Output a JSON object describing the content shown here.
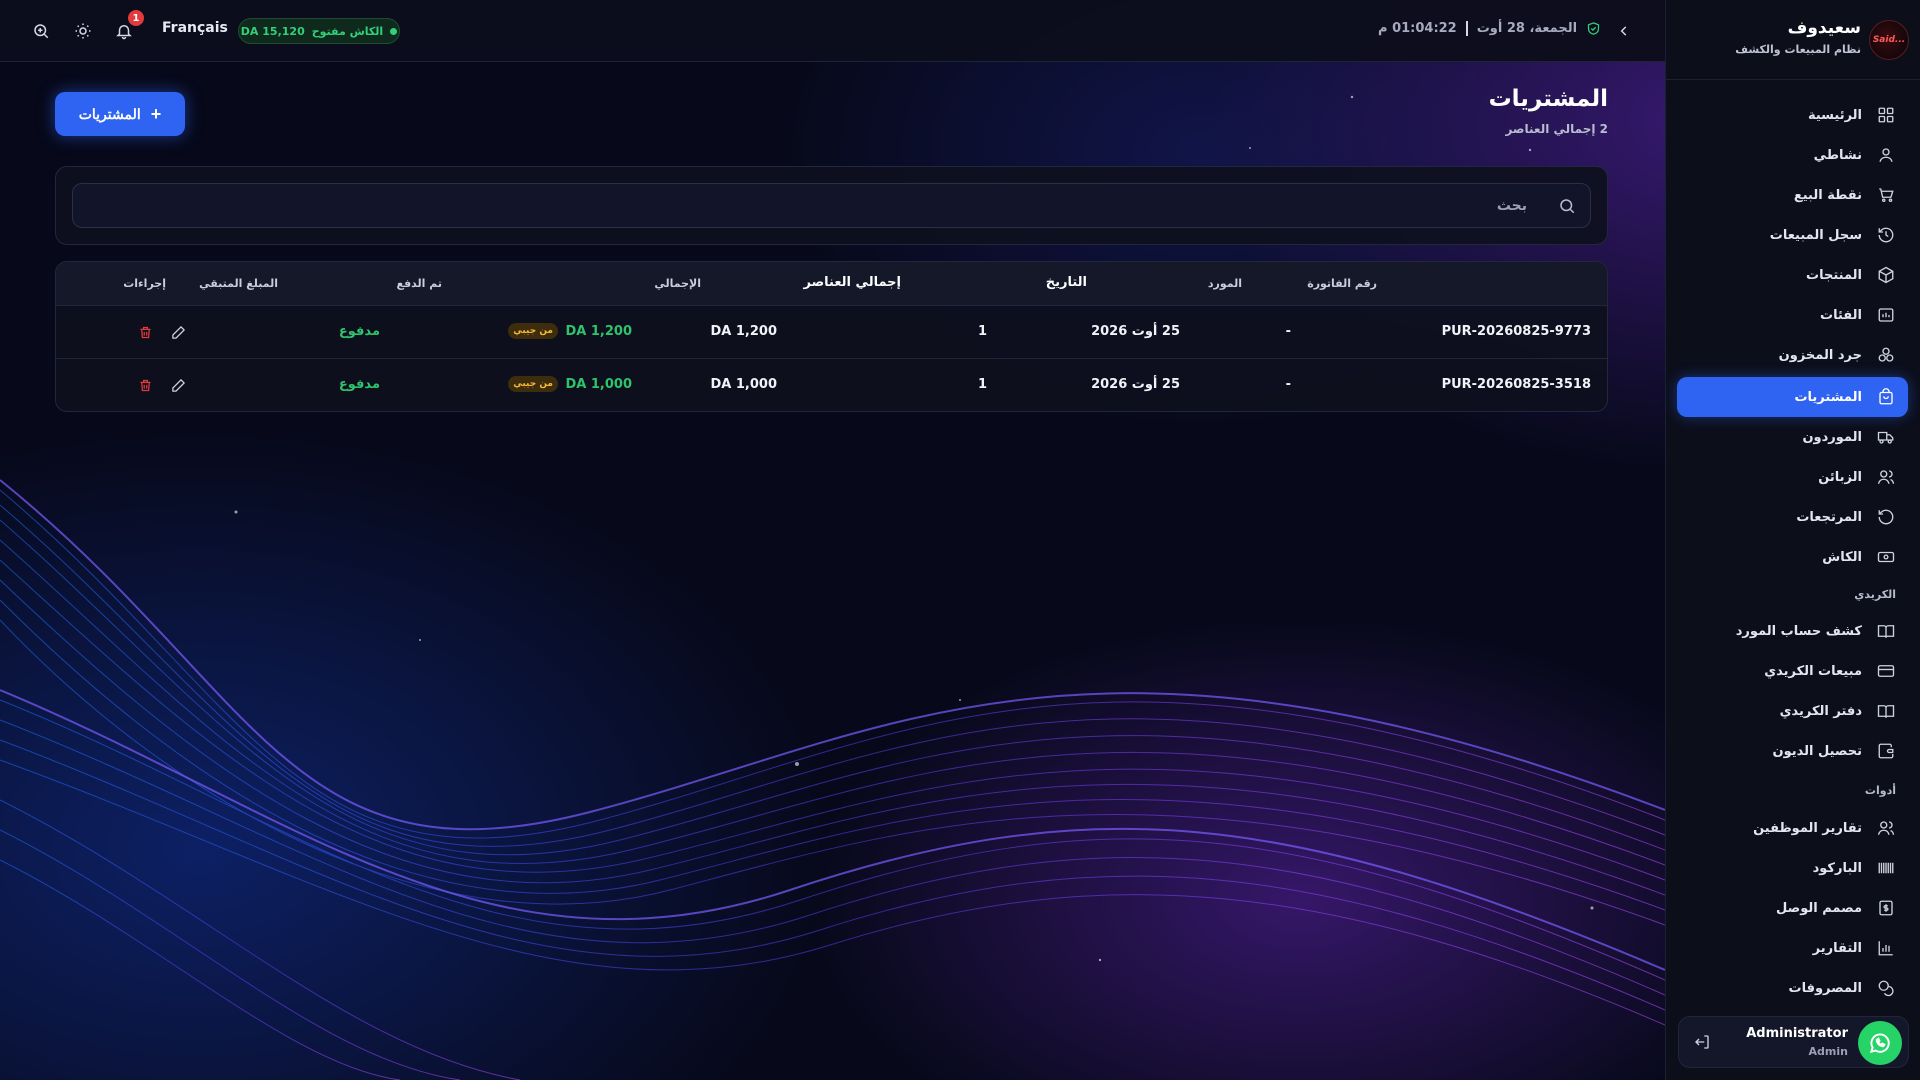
{
  "topbar": {
    "language": "Français",
    "cash_status": "الكاش مفتوح",
    "cash_amount": "DA 15,120",
    "date": "الجمعة، 28 أوت",
    "time": "01:04:22 م",
    "notifications_count": "1"
  },
  "brand": {
    "name": "سعيدوف",
    "subtitle": "نظام المبيعات والكشف",
    "logo_text": "Said..."
  },
  "sidebar": {
    "items": [
      {
        "label": "الرئيسية",
        "icon": "grid-icon"
      },
      {
        "label": "نشاطي",
        "icon": "user-icon"
      },
      {
        "label": "نقطة البيع",
        "icon": "cart-icon"
      },
      {
        "label": "سجل المبيعات",
        "icon": "history-icon"
      },
      {
        "label": "المنتجات",
        "icon": "box-icon"
      },
      {
        "label": "الفئات",
        "icon": "category-icon"
      },
      {
        "label": "جرد المخزون",
        "icon": "stock-icon"
      },
      {
        "label": "المشتريات",
        "icon": "bag-icon"
      },
      {
        "label": "الموردون",
        "icon": "truck-icon"
      },
      {
        "label": "الزبائن",
        "icon": "users-icon"
      },
      {
        "label": "المرتجعات",
        "icon": "return-icon"
      },
      {
        "label": "الكاش",
        "icon": "cash-icon"
      }
    ],
    "credit_section": "الكريدي",
    "credit_items": [
      {
        "label": "كشف حساب المورد",
        "icon": "book-icon"
      },
      {
        "label": "مبيعات الكريدي",
        "icon": "card-icon"
      },
      {
        "label": "دفتر الكريدي",
        "icon": "book-icon"
      },
      {
        "label": "تحصيل الديون",
        "icon": "wallet-icon"
      }
    ],
    "tools_section": "أدوات",
    "tools_items": [
      {
        "label": "تقارير الموظفين",
        "icon": "users-icon"
      },
      {
        "label": "الباركود",
        "icon": "barcode-icon"
      },
      {
        "label": "مصمم الوصل",
        "icon": "receipt-icon"
      },
      {
        "label": "التقارير",
        "icon": "chart-icon"
      },
      {
        "label": "المصروفات",
        "icon": "coins-icon"
      }
    ]
  },
  "user": {
    "name": "Administrator",
    "role": "Admin"
  },
  "page": {
    "title": "المشتريات",
    "subtitle": "2 إجمالي العناصر",
    "add_button": "المشتريات",
    "search_placeholder": "بحث"
  },
  "table": {
    "headers": {
      "invoice": "رقم الفاتورة",
      "supplier": "المورد",
      "date": "التاريخ",
      "items_total": "إجمالي العناصر",
      "total": "الإجمالي",
      "paid": "تم الدفع",
      "remaining": "المبلغ المتبقي",
      "actions": "إجراءات"
    },
    "rows": [
      {
        "invoice": "PUR-20260825-9773",
        "supplier": "-",
        "date": "25 أوت 2026",
        "items": "1",
        "total": "DA 1,200",
        "paid": "DA 1,200",
        "paid_source": "من جيبي",
        "remaining": "مدفوع"
      },
      {
        "invoice": "PUR-20260825-3518",
        "supplier": "-",
        "date": "25 أوت 2026",
        "items": "1",
        "total": "DA 1,000",
        "paid": "DA 1,000",
        "paid_source": "من جيبي",
        "remaining": "مدفوع"
      }
    ]
  },
  "colors": {
    "accent": "#2f63f2",
    "success": "#2fc36b",
    "danger": "#e23b3b",
    "badge": "#f5b83d"
  }
}
